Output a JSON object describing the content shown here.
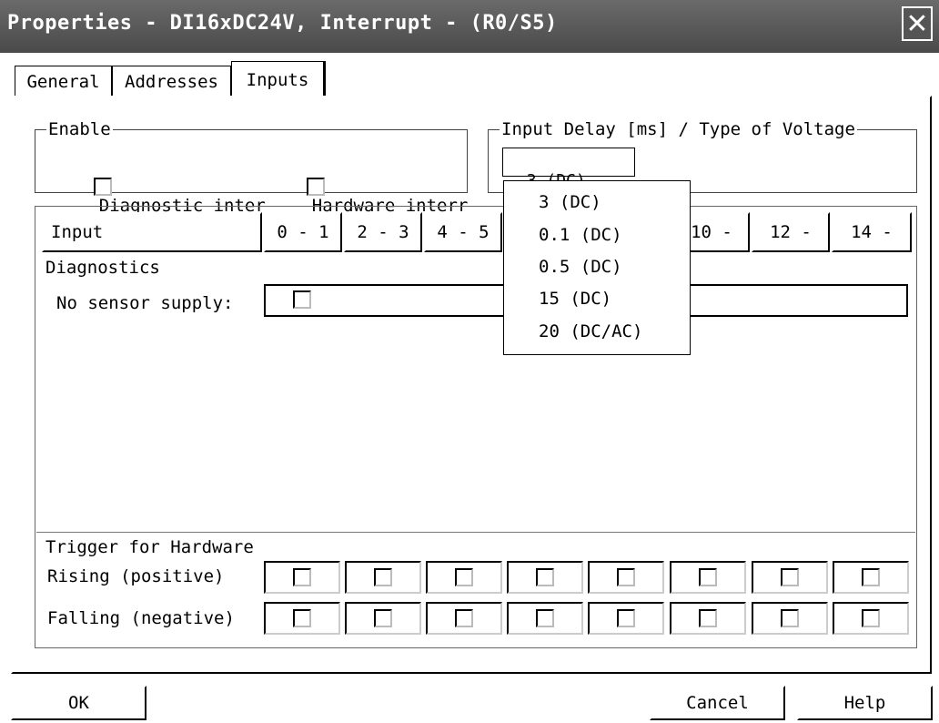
{
  "window": {
    "title": "Properties - DI16xDC24V, Interrupt - (R0/S5)"
  },
  "tabs": [
    {
      "label": "General"
    },
    {
      "label": "Addresses"
    },
    {
      "label": "Inputs"
    }
  ],
  "enable": {
    "legend": "Enable",
    "diagnostic_label": "Diagnostic inter",
    "hardware_label": "Hardware interr"
  },
  "delay": {
    "legend": "Input Delay [ms] / Type of Voltage",
    "value": "3 (DC)",
    "options": [
      "3 (DC)",
      "0.1 (DC)",
      "0.5 (DC)",
      "15 (DC)",
      "20 (DC/AC)"
    ]
  },
  "table": {
    "input_label": "Input",
    "columns": [
      "0 - 1",
      "2 - 3",
      "4 - 5",
      "10 -",
      "12 -",
      "14 -"
    ],
    "diagnostics_label": "Diagnostics",
    "no_sensor_label": "No sensor supply:",
    "trigger_label": "Trigger for Hardware",
    "rising_label": "Rising (positive)",
    "falling_label": "Falling (negative)"
  },
  "buttons": {
    "ok": "OK",
    "cancel": "Cancel",
    "help": "Help"
  }
}
